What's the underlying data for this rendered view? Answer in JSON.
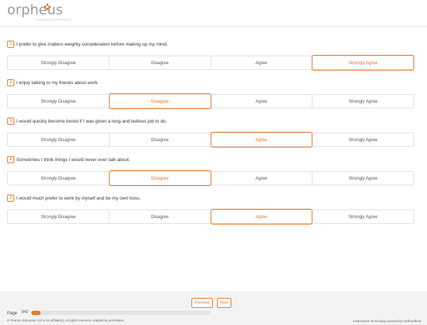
{
  "brand": {
    "name": "orpheus",
    "tagline": "THINKING DIFFERENTLY",
    "accent_color": "#e87722"
  },
  "questions": [
    {
      "number": "1",
      "text": "I prefer to give matters weighty consideration before making up my mind.",
      "selected": "Strongly Agree"
    },
    {
      "number": "2",
      "text": "I enjoy talking to my friends about work.",
      "selected": "Disagree"
    },
    {
      "number": "3",
      "text": "I would quickly become bored if I was given a long and tedious job to do.",
      "selected": "Agree"
    },
    {
      "number": "4",
      "text": "Sometimes I think things I would never ever talk about.",
      "selected": "Disagree"
    },
    {
      "number": "5",
      "text": "I would much prefer to work by myself and be my own boss.",
      "selected": "Agree"
    }
  ],
  "options": [
    "Strongly Disagree",
    "Disagree",
    "Agree",
    "Strongly Agree"
  ],
  "footer": {
    "prev_label": "Previous",
    "next_label": "Next",
    "page_label": "Page",
    "page_current": "3",
    "page_total": "42",
    "page_display": "3/42",
    "progress_fraction": 0.05,
    "copyright": "© Pearson Education Ltd or its affiliate(s). All rights reserved. Adapted by permission",
    "powered_by": "Assessment technology powered by Getfeedback"
  }
}
